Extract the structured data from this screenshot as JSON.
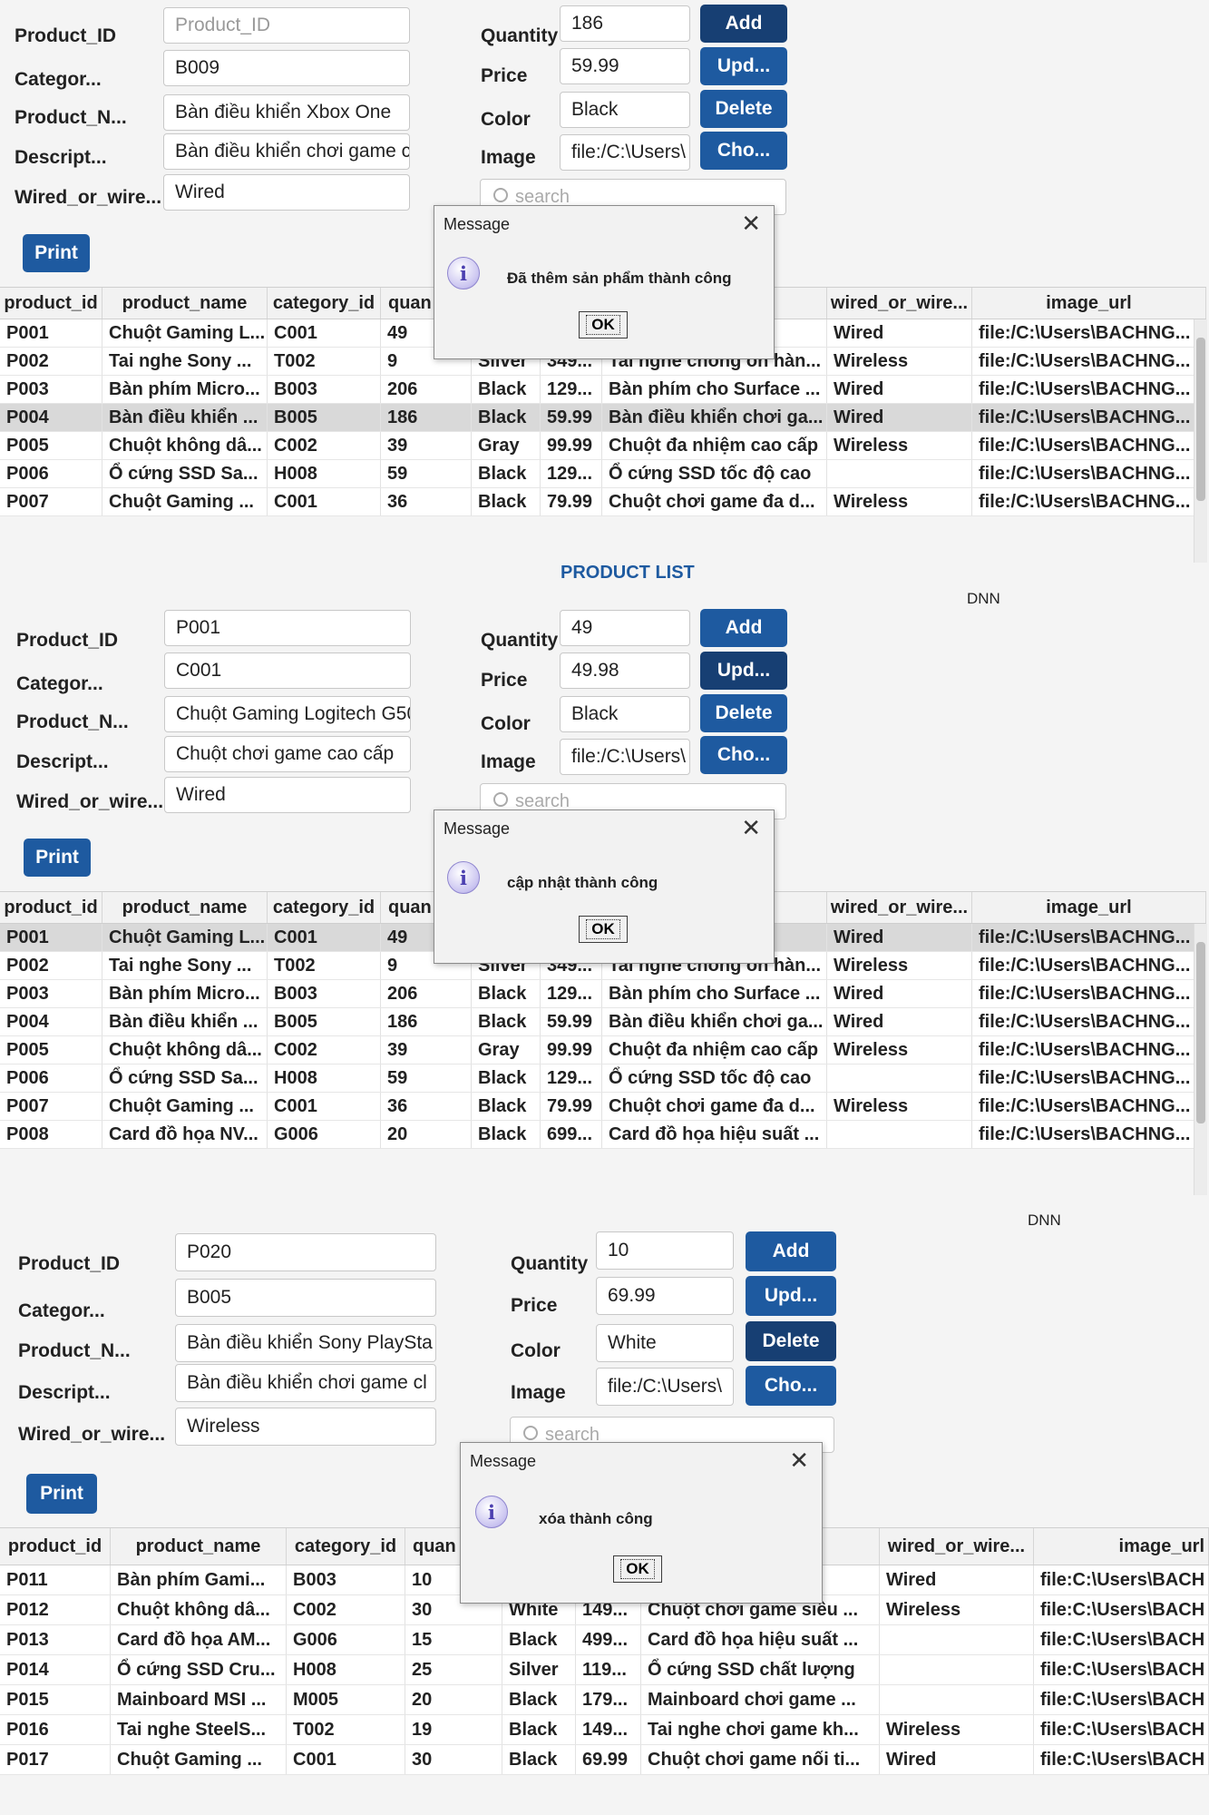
{
  "form_labels": {
    "product_id": "Product_ID",
    "category": "Categor...",
    "product_name": "Product_N...",
    "description": "Descript...",
    "wired": "Wired_or_wire...",
    "quantity": "Quantity",
    "price": "Price",
    "color": "Color",
    "image": "Image"
  },
  "buttons": {
    "add": "Add",
    "update": "Upd...",
    "delete": "Delete",
    "choose": "Cho...",
    "print": "Print"
  },
  "search_placeholder": "search",
  "dialog": {
    "title": "Message",
    "ok": "OK",
    "close": "✕",
    "info": "i"
  },
  "columns": [
    "product_id",
    "product_name",
    "category_id",
    "quan",
    "",
    "",
    "",
    "wired_or_wire...",
    "image_url"
  ],
  "panel1": {
    "form": {
      "product_id": "Product_ID",
      "category": "B009",
      "product_name": "Bàn điều khiển Xbox One",
      "description": "Bàn điều khiển chơi game cc",
      "wired": "Wired",
      "quantity": "186",
      "price": "59.99",
      "color": "Black",
      "image": "file:/C:\\Users\\"
    },
    "message": "Đã thêm sản phẩm thành công",
    "rows": [
      [
        "P001",
        "Chuột Gaming L...",
        "C001",
        "49",
        "",
        "",
        "...o c...",
        "Wired",
        "file:/C:\\Users\\BACHNG..."
      ],
      [
        "P002",
        "Tai nghe Sony ...",
        "T002",
        "9",
        "Silver",
        "349...",
        "Tai nghe chống ồn hàn...",
        "Wireless",
        "file:/C:\\Users\\BACHNG..."
      ],
      [
        "P003",
        "Bàn phím Micro...",
        "B003",
        "206",
        "Black",
        "129...",
        "Bàn phím cho Surface ...",
        "Wired",
        "file:/C:\\Users\\BACHNG..."
      ],
      [
        "P004",
        "Bàn điều khiển ...",
        "B005",
        "186",
        "Black",
        "59.99",
        "Bàn điều khiển chơi ga...",
        "Wired",
        "file:/C:\\Users\\BACHNG..."
      ],
      [
        "P005",
        "Chuột không dâ...",
        "C002",
        "39",
        "Gray",
        "99.99",
        "Chuột đa nhiệm cao cấp",
        "Wireless",
        "file:/C:\\Users\\BACHNG..."
      ],
      [
        "P006",
        "Ổ cứng SSD Sa...",
        "H008",
        "59",
        "Black",
        "129...",
        "Ổ cứng SSD tốc độ cao",
        "",
        "file:/C:\\Users\\BACHNG..."
      ],
      [
        "P007",
        "Chuột Gaming ...",
        "C001",
        "36",
        "Black",
        "79.99",
        "Chuột chơi game đa d...",
        "Wireless",
        "file:/C:\\Users\\BACHNG..."
      ]
    ]
  },
  "panel2": {
    "title": "PRODUCT LIST",
    "dnn": "DNN",
    "form": {
      "product_id": "P001",
      "category": "C001",
      "product_name": "Chuột Gaming Logitech G50",
      "description": "Chuột chơi game cao cấp",
      "wired": "Wired",
      "quantity": "49",
      "price": "49.98",
      "color": "Black",
      "image": "file:/C:\\Users\\"
    },
    "message": "cập nhật thành công",
    "rows": [
      [
        "P001",
        "Chuột Gaming L...",
        "C001",
        "49",
        "",
        "",
        "...o c...",
        "Wired",
        "file:/C:\\Users\\BACHNG..."
      ],
      [
        "P002",
        "Tai nghe Sony ...",
        "T002",
        "9",
        "Silver",
        "349...",
        "Tai nghe chống ồn hàn...",
        "Wireless",
        "file:/C:\\Users\\BACHNG..."
      ],
      [
        "P003",
        "Bàn phím Micro...",
        "B003",
        "206",
        "Black",
        "129...",
        "Bàn phím cho Surface ...",
        "Wired",
        "file:/C:\\Users\\BACHNG..."
      ],
      [
        "P004",
        "Bàn điều khiển ...",
        "B005",
        "186",
        "Black",
        "59.99",
        "Bàn điều khiển chơi ga...",
        "Wired",
        "file:/C:\\Users\\BACHNG..."
      ],
      [
        "P005",
        "Chuột không dâ...",
        "C002",
        "39",
        "Gray",
        "99.99",
        "Chuột đa nhiệm cao cấp",
        "Wireless",
        "file:/C:\\Users\\BACHNG..."
      ],
      [
        "P006",
        "Ổ cứng SSD Sa...",
        "H008",
        "59",
        "Black",
        "129...",
        "Ổ cứng SSD tốc độ cao",
        "",
        "file:/C:\\Users\\BACHNG..."
      ],
      [
        "P007",
        "Chuột Gaming ...",
        "C001",
        "36",
        "Black",
        "79.99",
        "Chuột chơi game đa d...",
        "Wireless",
        "file:/C:\\Users\\BACHNG..."
      ],
      [
        "P008",
        "Card đồ họa NV...",
        "G006",
        "20",
        "Black",
        "699...",
        "Card đồ họa hiệu suất ...",
        "",
        "file:/C:\\Users\\BACHNG..."
      ]
    ]
  },
  "panel3": {
    "dnn": "DNN",
    "form": {
      "product_id": "P020",
      "category": "B005",
      "product_name": "Bàn điều khiển Sony PlaySta",
      "description": "Bàn điều khiển chơi game cl",
      "wired": "Wireless",
      "quantity": "10",
      "price": "69.99",
      "color": "White",
      "image": "file:/C:\\Users\\"
    },
    "message": "xóa thành công",
    "rows": [
      [
        "P011",
        "Bàn phím Gami...",
        "B003",
        "10",
        "",
        "",
        "...e c...",
        "Wired",
        "file:C:\\Users\\BACH"
      ],
      [
        "P012",
        "Chuột không dâ...",
        "C002",
        "30",
        "White",
        "149...",
        "Chuột chơi game siêu ...",
        "Wireless",
        "file:C:\\Users\\BACH"
      ],
      [
        "P013",
        "Card đồ họa AM...",
        "G006",
        "15",
        "Black",
        "499...",
        "Card đồ họa hiệu suất ...",
        "",
        "file:C:\\Users\\BACH"
      ],
      [
        "P014",
        "Ổ cứng SSD Cru...",
        "H008",
        "25",
        "Silver",
        "119...",
        "Ổ cứng SSD chất lượng",
        "",
        "file:C:\\Users\\BACH"
      ],
      [
        "P015",
        "Mainboard MSI ...",
        "M005",
        "20",
        "Black",
        "179...",
        "Mainboard chơi game ...",
        "",
        "file:C:\\Users\\BACH"
      ],
      [
        "P016",
        "Tai nghe SteelS...",
        "T002",
        "19",
        "Black",
        "149...",
        "Tai nghe chơi game kh...",
        "Wireless",
        "file:C:\\Users\\BACH"
      ],
      [
        "P017",
        "Chuột Gaming ...",
        "C001",
        "30",
        "Black",
        "69.99",
        "Chuột chơi game nối ti...",
        "Wired",
        "file:C:\\Users\\BACH"
      ]
    ]
  }
}
